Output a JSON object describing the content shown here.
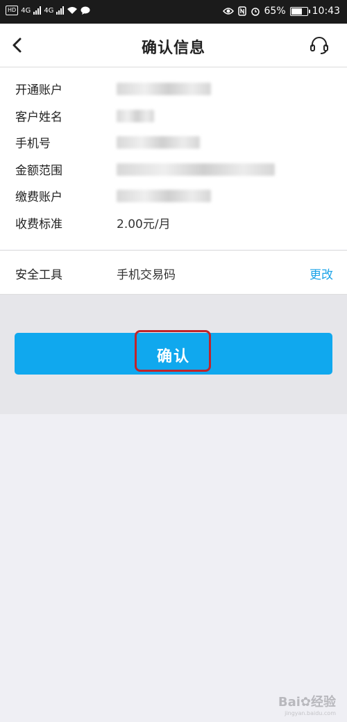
{
  "status_bar": {
    "hd": "HD",
    "net1": "4G",
    "net2": "4G",
    "battery": "65%",
    "battery_level": 0.65,
    "time": "10:43"
  },
  "nav": {
    "title": "确认信息",
    "back_icon": "chevron-left-icon",
    "service_icon": "headset-icon"
  },
  "info_rows": [
    {
      "label": "开通账户",
      "value": ""
    },
    {
      "label": "客户姓名",
      "value": ""
    },
    {
      "label": "手机号",
      "value": ""
    },
    {
      "label": "金额范围",
      "value": ""
    },
    {
      "label": "缴费账户",
      "value": ""
    },
    {
      "label": "收费标准",
      "value": "2.00元/月"
    }
  ],
  "security": {
    "label": "安全工具",
    "value": "手机交易码",
    "change": "更改"
  },
  "confirm_button": {
    "label": "确认"
  },
  "watermark": {
    "brand": "Bai",
    "brand2": "经验",
    "url": "jingyan.baidu.com"
  },
  "colors": {
    "accent": "#10a8ee",
    "link": "#1aa3e8",
    "highlight_border": "#c0242b"
  }
}
